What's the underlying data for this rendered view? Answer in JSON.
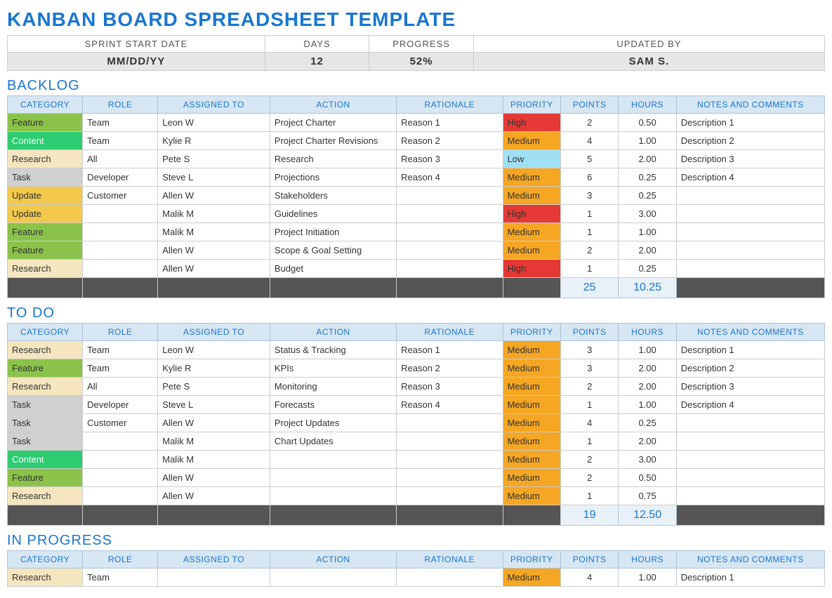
{
  "title": "KANBAN BOARD SPREADSHEET TEMPLATE",
  "meta": {
    "headers": [
      "SPRINT START DATE",
      "DAYS",
      "PROGRESS",
      "UPDATED BY"
    ],
    "values": [
      "MM/DD/YY",
      "12",
      "52%",
      "SAM S."
    ]
  },
  "columns": [
    "CATEGORY",
    "ROLE",
    "ASSIGNED TO",
    "ACTION",
    "RATIONALE",
    "PRIORITY",
    "POINTS",
    "HOURS",
    "NOTES AND COMMENTS"
  ],
  "sections": [
    {
      "title": "BACKLOG",
      "rows": [
        {
          "category": "Feature",
          "role": "Team",
          "assigned": "Leon W",
          "action": "Project Charter",
          "rationale": "Reason 1",
          "priority": "High",
          "points": "2",
          "hours": "0.50",
          "notes": "Description 1"
        },
        {
          "category": "Content",
          "role": "Team",
          "assigned": "Kylie R",
          "action": "Project Charter Revisions",
          "rationale": "Reason 2",
          "priority": "Medium",
          "points": "4",
          "hours": "1.00",
          "notes": "Description 2"
        },
        {
          "category": "Research",
          "role": "All",
          "assigned": "Pete S",
          "action": "Research",
          "rationale": "Reason 3",
          "priority": "Low",
          "points": "5",
          "hours": "2.00",
          "notes": "Description 3"
        },
        {
          "category": "Task",
          "role": "Developer",
          "assigned": "Steve L",
          "action": "Projections",
          "rationale": "Reason 4",
          "priority": "Medium",
          "points": "6",
          "hours": "0.25",
          "notes": "Description 4"
        },
        {
          "category": "Update",
          "role": "Customer",
          "assigned": "Allen W",
          "action": "Stakeholders",
          "rationale": "",
          "priority": "Medium",
          "points": "3",
          "hours": "0.25",
          "notes": ""
        },
        {
          "category": "Update",
          "role": "",
          "assigned": "Malik M",
          "action": "Guidelines",
          "rationale": "",
          "priority": "High",
          "points": "1",
          "hours": "3.00",
          "notes": ""
        },
        {
          "category": "Feature",
          "role": "",
          "assigned": "Malik M",
          "action": "Project Initiation",
          "rationale": "",
          "priority": "Medium",
          "points": "1",
          "hours": "1.00",
          "notes": ""
        },
        {
          "category": "Feature",
          "role": "",
          "assigned": "Allen W",
          "action": "Scope & Goal Setting",
          "rationale": "",
          "priority": "Medium",
          "points": "2",
          "hours": "2.00",
          "notes": ""
        },
        {
          "category": "Research",
          "role": "",
          "assigned": "Allen W",
          "action": "Budget",
          "rationale": "",
          "priority": "High",
          "points": "1",
          "hours": "0.25",
          "notes": ""
        }
      ],
      "totals": {
        "points": "25",
        "hours": "10.25"
      }
    },
    {
      "title": "TO DO",
      "rows": [
        {
          "category": "Research",
          "role": "Team",
          "assigned": "Leon W",
          "action": "Status & Tracking",
          "rationale": "Reason 1",
          "priority": "Medium",
          "points": "3",
          "hours": "1.00",
          "notes": "Description 1"
        },
        {
          "category": "Feature",
          "role": "Team",
          "assigned": "Kylie R",
          "action": "KPIs",
          "rationale": "Reason 2",
          "priority": "Medium",
          "points": "3",
          "hours": "2.00",
          "notes": "Description 2"
        },
        {
          "category": "Research",
          "role": "All",
          "assigned": "Pete S",
          "action": "Monitoring",
          "rationale": "Reason 3",
          "priority": "Medium",
          "points": "2",
          "hours": "2.00",
          "notes": "Description 3"
        },
        {
          "category": "Task",
          "role": "Developer",
          "assigned": "Steve L",
          "action": "Forecasts",
          "rationale": "Reason 4",
          "priority": "Medium",
          "points": "1",
          "hours": "1.00",
          "notes": "Description 4"
        },
        {
          "category": "Task",
          "role": "Customer",
          "assigned": "Allen W",
          "action": "Project Updates",
          "rationale": "",
          "priority": "Medium",
          "points": "4",
          "hours": "0.25",
          "notes": ""
        },
        {
          "category": "Task",
          "role": "",
          "assigned": "Malik M",
          "action": "Chart Updates",
          "rationale": "",
          "priority": "Medium",
          "points": "1",
          "hours": "2.00",
          "notes": ""
        },
        {
          "category": "Content",
          "role": "",
          "assigned": "Malik M",
          "action": "",
          "rationale": "",
          "priority": "Medium",
          "points": "2",
          "hours": "3.00",
          "notes": ""
        },
        {
          "category": "Feature",
          "role": "",
          "assigned": "Allen W",
          "action": "",
          "rationale": "",
          "priority": "Medium",
          "points": "2",
          "hours": "0.50",
          "notes": ""
        },
        {
          "category": "Research",
          "role": "",
          "assigned": "Allen W",
          "action": "",
          "rationale": "",
          "priority": "Medium",
          "points": "1",
          "hours": "0.75",
          "notes": ""
        }
      ],
      "totals": {
        "points": "19",
        "hours": "12.50"
      }
    },
    {
      "title": "IN PROGRESS",
      "rows": [
        {
          "category": "Research",
          "role": "Team",
          "assigned": "",
          "action": "",
          "rationale": "",
          "priority": "Medium",
          "points": "4",
          "hours": "1.00",
          "notes": "Description 1"
        }
      ],
      "totals": null
    }
  ]
}
